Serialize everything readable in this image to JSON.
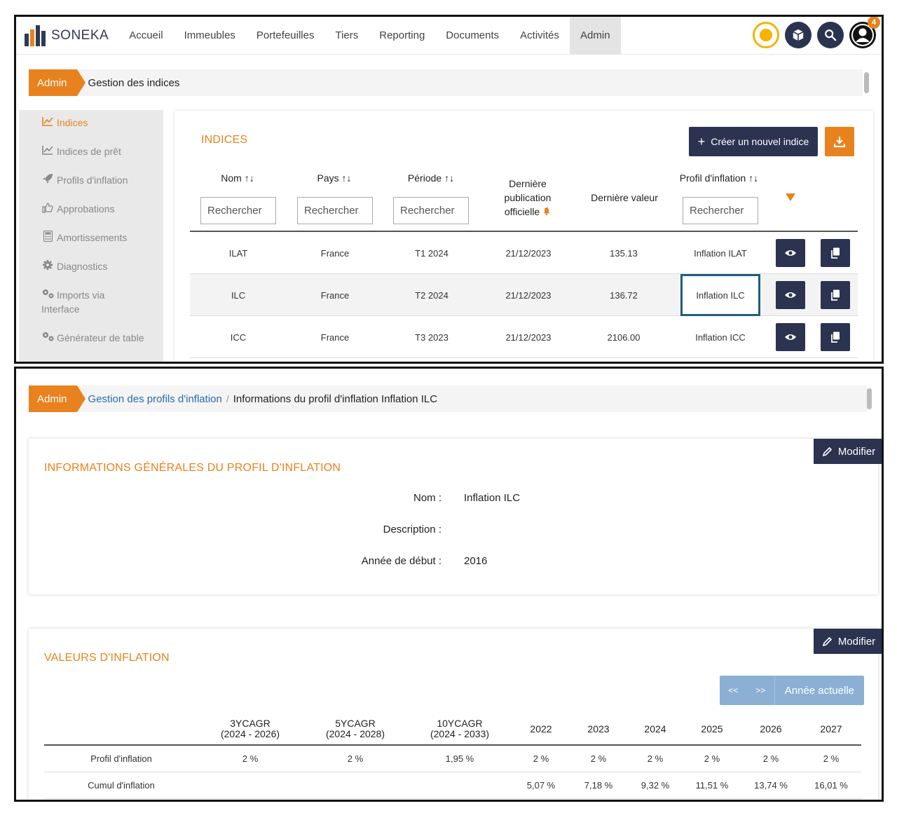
{
  "brand": {
    "name": "SONEKA",
    "accent": "#e8821e",
    "dark": "#2b3350"
  },
  "nav": {
    "items": [
      "Accueil",
      "Immeubles",
      "Portefeuilles",
      "Tiers",
      "Reporting",
      "Documents",
      "Activités",
      "Admin"
    ],
    "active": "Admin",
    "notification_count": "4",
    "icons": [
      "status-indicator-icon",
      "cube-icon",
      "search-icon",
      "user-avatar-icon"
    ]
  },
  "breadcrumb1": {
    "root": "Admin",
    "current": "Gestion des indices"
  },
  "sidebar": {
    "items": [
      {
        "label": "Indices",
        "icon": "chart-line-icon",
        "active": true
      },
      {
        "label": "Indices de prêt",
        "icon": "chart-line-icon"
      },
      {
        "label": "Profils d'inflation",
        "icon": "rocket-icon"
      },
      {
        "label": "Approbations",
        "icon": "thumbs-up-icon"
      },
      {
        "label": "Amortissements",
        "icon": "calculator-icon"
      },
      {
        "label": "Diagnostics",
        "icon": "gear-icon"
      },
      {
        "label": "Imports via",
        "label2": "Interface",
        "icon": "gears-icon"
      },
      {
        "label": "Générateur de table",
        "icon": "gears-icon"
      }
    ]
  },
  "indices": {
    "title": "INDICES",
    "create_label": "Créer un nouvel indice",
    "columns": {
      "nom": "Nom",
      "pays": "Pays",
      "periode": "Période",
      "pub1": "Dernière",
      "pub2": "publication",
      "pub3": "officielle",
      "valeur": "Dernière valeur",
      "profil": "Profil d'inflation"
    },
    "sort_glyph": "↑↓",
    "search_placeholder": "Rechercher",
    "rows": [
      {
        "nom": "ILAT",
        "pays": "France",
        "periode": "T1 2024",
        "publication": "21/12/2023",
        "valeur": "135.13",
        "profil": "Inflation ILAT"
      },
      {
        "nom": "ILC",
        "pays": "France",
        "periode": "T2 2024",
        "publication": "21/12/2023",
        "valeur": "136.72",
        "profil": "Inflation ILC"
      },
      {
        "nom": "ICC",
        "pays": "France",
        "periode": "T3 2023",
        "publication": "21/12/2023",
        "valeur": "2106.00",
        "profil": "Inflation ICC"
      }
    ]
  },
  "breadcrumb2": {
    "root": "Admin",
    "link": "Gestion des profils d'inflation",
    "separator": "/",
    "current": "Informations du profil d'inflation Inflation ILC"
  },
  "general": {
    "title": "INFORMATIONS GÉNÉRALES DU PROFIL D'INFLATION",
    "modify_label": "Modifier",
    "fields": [
      {
        "label": "Nom :",
        "value": "Inflation ILC"
      },
      {
        "label": "Description :",
        "value": ""
      },
      {
        "label": "Année de début :",
        "value": "2016"
      }
    ]
  },
  "values": {
    "title": "VALEURS D'INFLATION",
    "modify_label": "Modifier",
    "pager": {
      "prev": "<<",
      "next": ">>",
      "current_year": "Année actuelle"
    },
    "headers": [
      {
        "l1": "3YCAGR",
        "l2": "(2024 - 2026)"
      },
      {
        "l1": "5YCAGR",
        "l2": "(2024 - 2028)"
      },
      {
        "l1": "10YCAGR",
        "l2": "(2024 - 2033)"
      },
      {
        "l1": "2022",
        "l2": ""
      },
      {
        "l1": "2023",
        "l2": ""
      },
      {
        "l1": "2024",
        "l2": ""
      },
      {
        "l1": "2025",
        "l2": ""
      },
      {
        "l1": "2026",
        "l2": ""
      },
      {
        "l1": "2027",
        "l2": ""
      }
    ],
    "rows": [
      {
        "label": "Profil d'inflation",
        "cells": [
          "2 %",
          "2 %",
          "1,95 %",
          "2 %",
          "2 %",
          "2 %",
          "2 %",
          "2 %",
          "2 %"
        ]
      },
      {
        "label": "Cumul d'inflation",
        "cells": [
          "",
          "",
          "",
          "5,07 %",
          "7,18 %",
          "9,32 %",
          "11,51 %",
          "13,74 %",
          "16,01 %"
        ]
      }
    ]
  }
}
